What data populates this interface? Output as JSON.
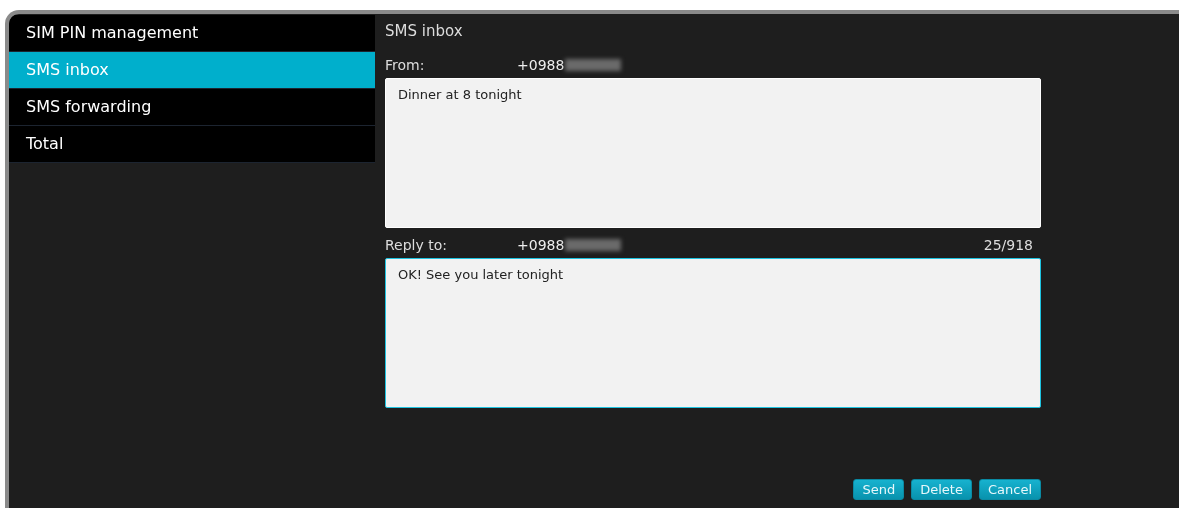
{
  "sidebar": {
    "items": [
      {
        "label": "SIM PIN management",
        "selected": false
      },
      {
        "label": "SMS inbox",
        "selected": true
      },
      {
        "label": "SMS forwarding",
        "selected": false
      },
      {
        "label": "Total",
        "selected": false
      }
    ]
  },
  "panel": {
    "title": "SMS inbox",
    "from": {
      "label": "From:",
      "number": "+0988",
      "message": "Dinner at 8 tonight"
    },
    "reply": {
      "label": "Reply to:",
      "number": "+0988",
      "counter": "25/918",
      "message": "OK! See you later tonight",
      "focused": true
    },
    "buttons": [
      "Send",
      "Delete",
      "Cancel"
    ]
  }
}
